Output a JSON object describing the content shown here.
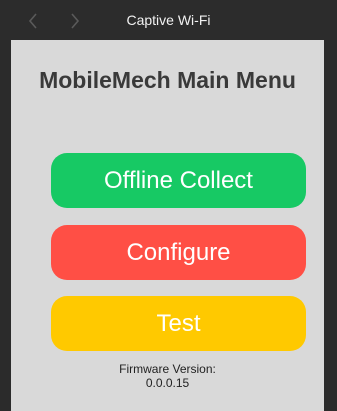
{
  "window": {
    "title": "Captive Wi-Fi",
    "nav": {
      "back_icon": "chevron-left-icon",
      "forward_icon": "chevron-right-icon"
    }
  },
  "main": {
    "heading": "MobileMech Main Menu",
    "buttons": [
      {
        "label": "Offline Collect",
        "color": "#17c964"
      },
      {
        "label": "Configure",
        "color": "#ff4f45"
      },
      {
        "label": "Test",
        "color": "#ffc900"
      }
    ],
    "firmware": {
      "label": "Firmware Version:",
      "value": "0.0.0.15"
    }
  },
  "colors": {
    "titlebar": "#2c2c2c",
    "background": "#d9d9d9",
    "heading_text": "#3a3a3a"
  }
}
